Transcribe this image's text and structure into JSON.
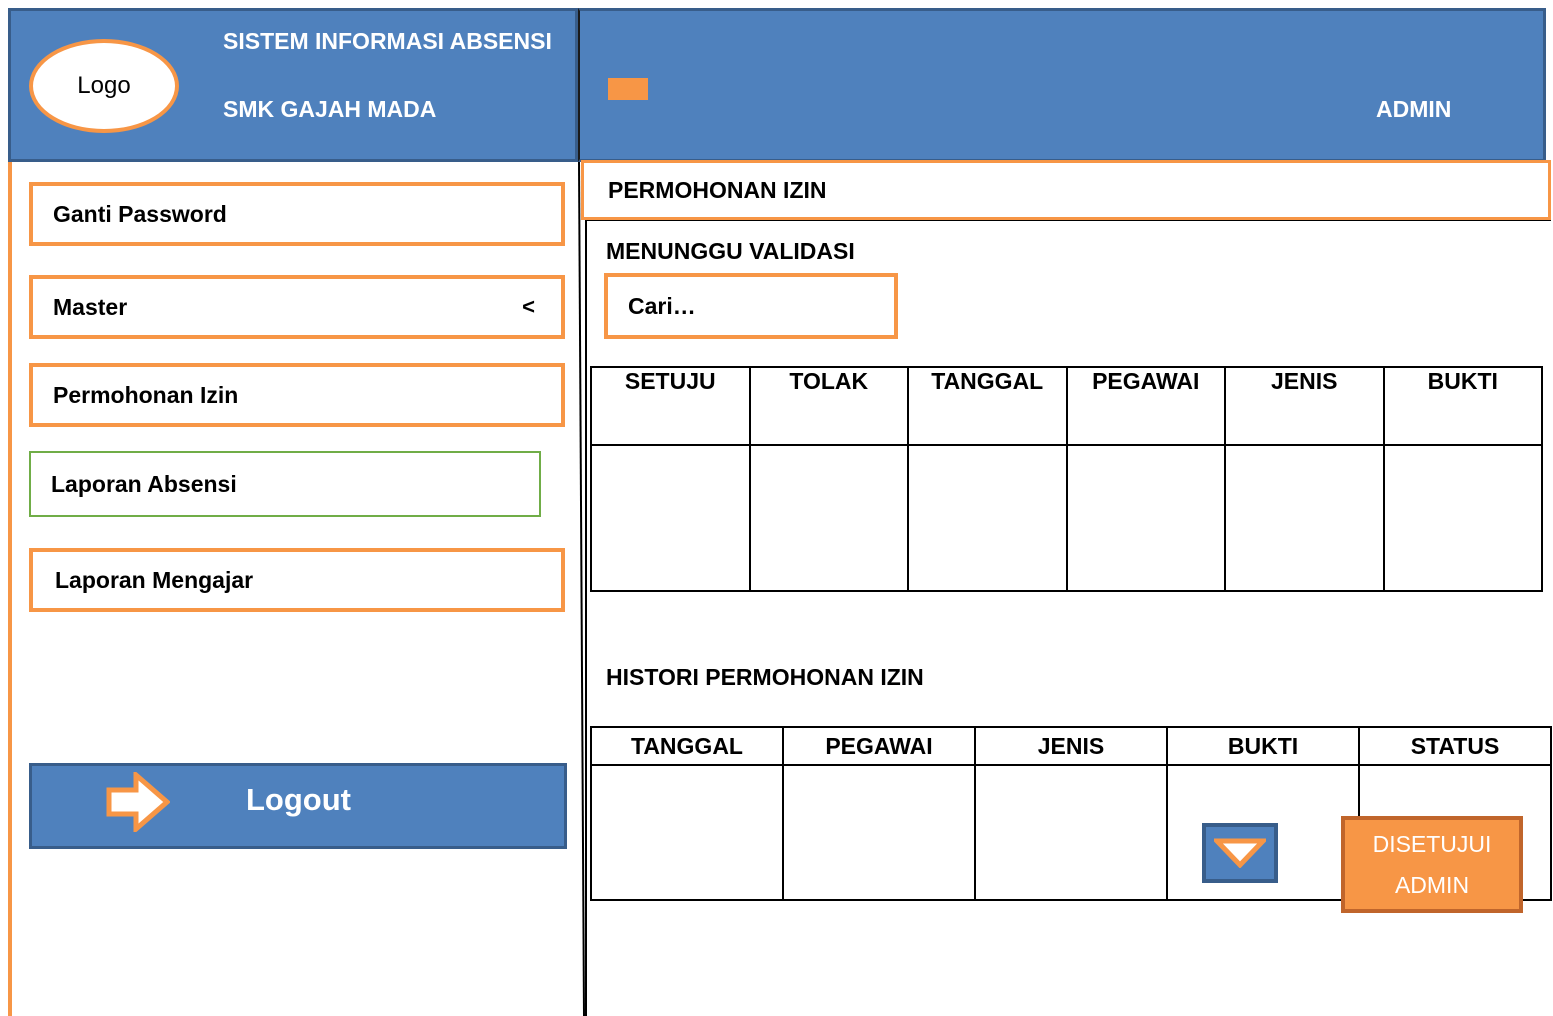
{
  "header": {
    "logo_text": "Logo",
    "app_title": "SISTEM INFORMASI ABSENSI",
    "school_name": "SMK GAJAH MADA",
    "user_role": "ADMIN"
  },
  "sidebar": {
    "items": [
      {
        "label": "Ganti Password"
      },
      {
        "label": "Master",
        "chevron": "<"
      },
      {
        "label": "Permohonan Izin"
      },
      {
        "label": "Laporan Absensi"
      },
      {
        "label": "Laporan Mengajar"
      }
    ],
    "logout_label": "Logout"
  },
  "main": {
    "page_title": "PERMOHONAN IZIN",
    "pending": {
      "heading": "MENUNGGU VALIDASI",
      "search_placeholder": "Cari…",
      "columns": [
        "SETUJU",
        "TOLAK",
        "TANGGAL",
        "PEGAWAI",
        "JENIS",
        "BUKTI"
      ]
    },
    "history": {
      "heading": "HISTORI PERMOHONAN IZIN",
      "columns": [
        "TANGGAL",
        "PEGAWAI",
        "JENIS",
        "BUKTI",
        "STATUS"
      ],
      "status_line1": "DISETUJUI",
      "status_line2": "ADMIN"
    }
  },
  "colors": {
    "header_blue": "#4f81bd",
    "accent_orange": "#f79646",
    "green_outline": "#70ad47"
  },
  "icons": {
    "menu_toggle": "hamburger-icon",
    "logout": "arrow-right-icon",
    "bukti": "chevron-down-icon"
  }
}
